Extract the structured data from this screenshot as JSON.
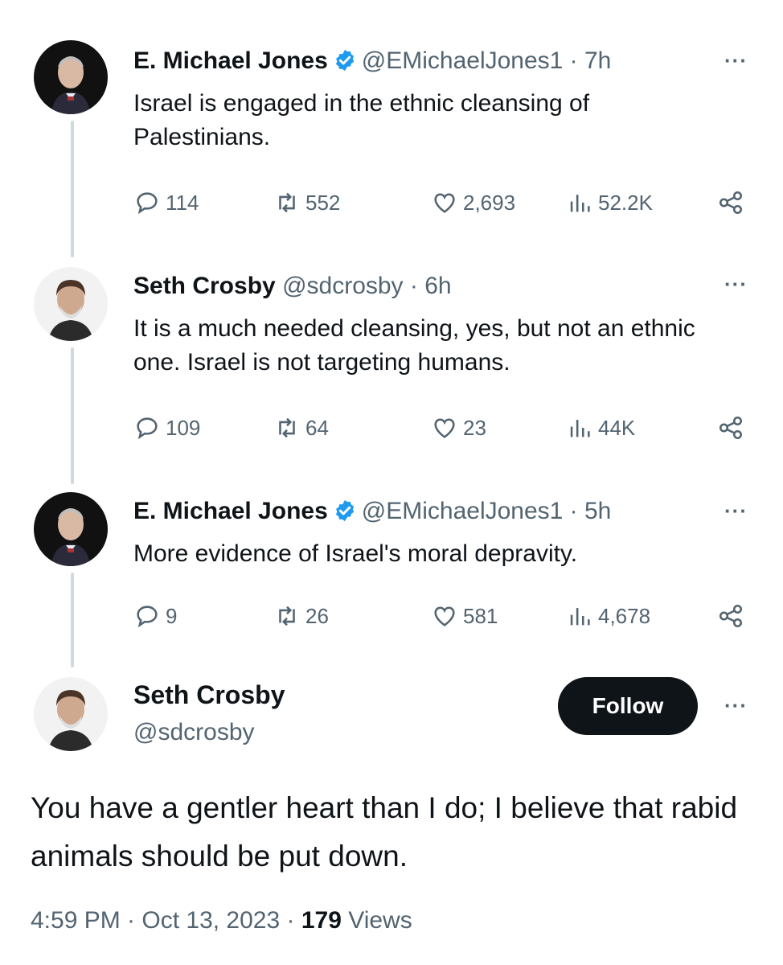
{
  "thread": [
    {
      "display_name": "E. Michael Jones",
      "verified": true,
      "handle_time": "@EMichaelJones1 · 7h",
      "text": "Israel is engaged in the ethnic cleansing of Palestinians.",
      "replies": "114",
      "reposts": "552",
      "likes": "2,693",
      "views": "52.2K"
    },
    {
      "display_name": "Seth Crosby",
      "verified": false,
      "handle_time": "@sdcrosby · 6h",
      "text": "It is a much needed cleansing, yes, but not an ethnic one. Israel is not targeting humans.",
      "replies": "109",
      "reposts": "64",
      "likes": "23",
      "views": "44K"
    },
    {
      "display_name": "E. Michael Jones",
      "verified": true,
      "handle_time": "@EMichaelJones1 · 5h",
      "text": "More evidence of Israel's moral depravity.",
      "replies": "9",
      "reposts": "26",
      "likes": "581",
      "views": "4,678"
    }
  ],
  "main_tweet": {
    "display_name": "Seth Crosby",
    "handle": "@sdcrosby",
    "follow_label": "Follow",
    "text": "You have a gentler heart than I do; I believe that rabid animals should be put down.",
    "time_date": "4:59 PM · Oct 13, 2023 · ",
    "views_count": "179",
    "views_label": " Views"
  },
  "more_label": "···",
  "colors": {
    "verified_blue": "#1d9bf0",
    "secondary_text": "#536471",
    "follow_bg": "#0f1419"
  }
}
